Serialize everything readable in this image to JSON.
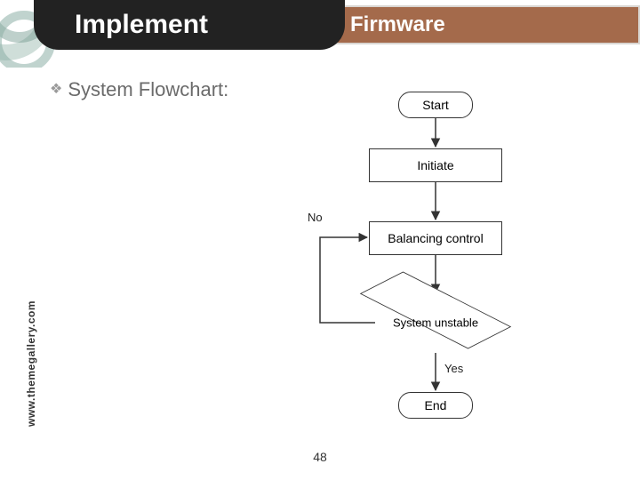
{
  "header": {
    "title_left": "Implement",
    "title_right": "Firmware"
  },
  "bullet": {
    "icon": "❖",
    "text": "System Flowchart:"
  },
  "footer": {
    "url": "www.themegallery.com",
    "page_number": "48"
  },
  "flowchart": {
    "nodes": {
      "start": {
        "label": "Start",
        "type": "terminator"
      },
      "initiate": {
        "label": "Initiate",
        "type": "process"
      },
      "balance": {
        "label": "Balancing control",
        "type": "process"
      },
      "decision": {
        "label": "System unstable",
        "type": "decision"
      },
      "end": {
        "label": "End",
        "type": "terminator"
      }
    },
    "edges": [
      {
        "from": "start",
        "to": "initiate"
      },
      {
        "from": "initiate",
        "to": "balance"
      },
      {
        "from": "balance",
        "to": "decision"
      },
      {
        "from": "decision",
        "to": "end",
        "label": "Yes"
      },
      {
        "from": "decision",
        "to": "balance",
        "label": "No"
      }
    ]
  },
  "colors": {
    "title_dark_bg": "#222222",
    "title_accent_bg": "#a46a4b",
    "bullet_text": "#6b6b6b"
  }
}
